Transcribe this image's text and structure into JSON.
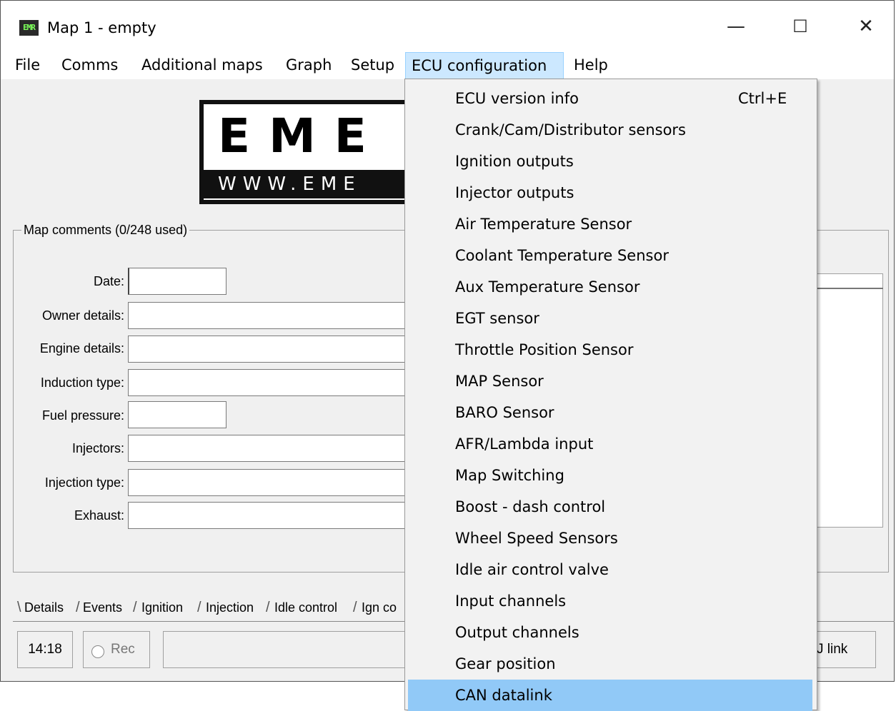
{
  "window": {
    "title": "Map 1 - empty",
    "icon_text": "EMR",
    "controls": {
      "minimize": "—",
      "maximize": "☐",
      "close": "✕"
    }
  },
  "menubar": {
    "items": [
      "File",
      "Comms",
      "Additional maps",
      "Graph",
      "Setup",
      "ECU configuration",
      "Help"
    ],
    "active": "ECU configuration"
  },
  "logo": {
    "letters": "EME",
    "url_text": "WWW.EME"
  },
  "map_comments": {
    "title": "Map comments (0/248 used)",
    "fields": [
      {
        "label": "Date:",
        "value": ""
      },
      {
        "label": "Owner details:",
        "value": ""
      },
      {
        "label": "Engine details:",
        "value": ""
      },
      {
        "label": "Induction type:",
        "value": ""
      },
      {
        "label": "Fuel pressure:",
        "value": ""
      },
      {
        "label": "Injectors:",
        "value": ""
      },
      {
        "label": "Injection type:",
        "value": ""
      },
      {
        "label": "Exhaust:",
        "value": ""
      }
    ]
  },
  "tabs": [
    "Details",
    "Events",
    "Ignition",
    "Injection",
    "Idle control",
    "Ign co"
  ],
  "status": {
    "time": "14:18",
    "rec_label": "Rec",
    "link_text": "J link"
  },
  "dropdown": {
    "items": [
      {
        "label": "ECU version info",
        "shortcut": "Ctrl+E"
      },
      {
        "label": "Crank/Cam/Distributor sensors"
      },
      {
        "label": "Ignition outputs"
      },
      {
        "label": "Injector outputs"
      },
      {
        "label": "Air Temperature Sensor"
      },
      {
        "label": "Coolant Temperature Sensor"
      },
      {
        "label": "Aux Temperature Sensor"
      },
      {
        "label": "EGT sensor"
      },
      {
        "label": "Throttle Position Sensor"
      },
      {
        "label": "MAP Sensor"
      },
      {
        "label": "BARO Sensor"
      },
      {
        "label": "AFR/Lambda input"
      },
      {
        "label": "Map Switching"
      },
      {
        "label": "Boost - dash control"
      },
      {
        "label": "Wheel Speed Sensors"
      },
      {
        "label": "Idle air control valve"
      },
      {
        "label": "Input channels"
      },
      {
        "label": "Output channels"
      },
      {
        "label": "Gear position"
      },
      {
        "label": "CAN datalink"
      }
    ],
    "highlighted": "CAN datalink"
  },
  "colors": {
    "menu_active_bg": "#cce8ff",
    "highlight_bg": "#91c9f7",
    "window_bg": "#f0f0f0"
  }
}
